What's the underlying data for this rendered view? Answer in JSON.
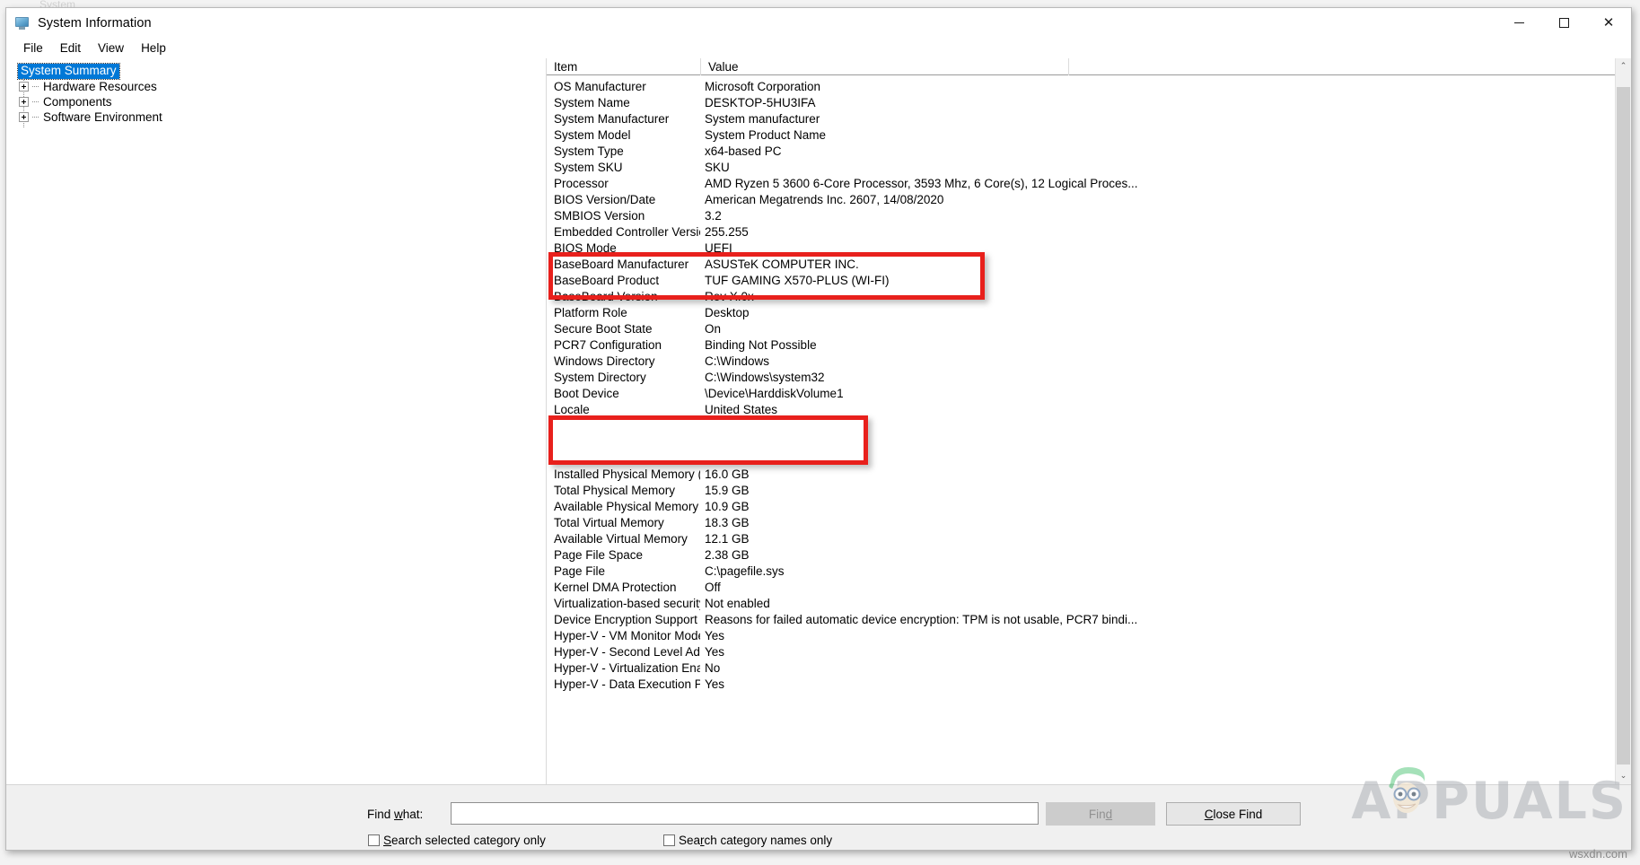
{
  "window": {
    "title": "System Information",
    "icon": "system-information-icon",
    "controls": {
      "minimize": "–",
      "maximize": "□",
      "close": "✕"
    }
  },
  "menu": {
    "items": [
      "File",
      "Edit",
      "View",
      "Help"
    ]
  },
  "tree": {
    "root": {
      "label": "System Summary",
      "selected": true
    },
    "children": [
      {
        "label": "Hardware Resources",
        "expanded": false
      },
      {
        "label": "Components",
        "expanded": false
      },
      {
        "label": "Software Environment",
        "expanded": false
      }
    ]
  },
  "list": {
    "columns": [
      "Item",
      "Value"
    ],
    "rows": [
      {
        "item": "OS Manufacturer",
        "value": "Microsoft Corporation"
      },
      {
        "item": "System Name",
        "value": "DESKTOP-5HU3IFA"
      },
      {
        "item": "System Manufacturer",
        "value": "System manufacturer"
      },
      {
        "item": "System Model",
        "value": "System Product Name"
      },
      {
        "item": "System Type",
        "value": "x64-based PC"
      },
      {
        "item": "System SKU",
        "value": "SKU"
      },
      {
        "item": "Processor",
        "value": "AMD Ryzen 5 3600 6-Core Processor, 3593 Mhz, 6 Core(s), 12 Logical Proces..."
      },
      {
        "item": "BIOS Version/Date",
        "value": "American Megatrends Inc. 2607, 14/08/2020"
      },
      {
        "item": "SMBIOS Version",
        "value": "3.2"
      },
      {
        "item": "Embedded Controller Version",
        "value": "255.255"
      },
      {
        "item": "BIOS Mode",
        "value": "UEFI"
      },
      {
        "item": "BaseBoard Manufacturer",
        "value": "ASUSTeK COMPUTER INC."
      },
      {
        "item": "BaseBoard Product",
        "value": "TUF GAMING X570-PLUS (WI-FI)"
      },
      {
        "item": "BaseBoard Version",
        "value": "Rev X.0x"
      },
      {
        "item": "Platform Role",
        "value": "Desktop"
      },
      {
        "item": "Secure Boot State",
        "value": "On"
      },
      {
        "item": "PCR7 Configuration",
        "value": "Binding Not Possible"
      },
      {
        "item": "Windows Directory",
        "value": "C:\\Windows"
      },
      {
        "item": "System Directory",
        "value": "C:\\Windows\\system32"
      },
      {
        "item": "Boot Device",
        "value": "\\Device\\HarddiskVolume1"
      },
      {
        "item": "Locale",
        "value": "United States"
      },
      {
        "item": "",
        "value": ""
      },
      {
        "item": "",
        "value": ""
      },
      {
        "item": "",
        "value": ""
      },
      {
        "item": "Installed Physical Memory (RAM)",
        "value": "16.0 GB"
      },
      {
        "item": "Total Physical Memory",
        "value": "15.9 GB"
      },
      {
        "item": "Available Physical Memory",
        "value": "10.9 GB"
      },
      {
        "item": "Total Virtual Memory",
        "value": "18.3 GB"
      },
      {
        "item": "Available Virtual Memory",
        "value": "12.1 GB"
      },
      {
        "item": "Page File Space",
        "value": "2.38 GB"
      },
      {
        "item": "Page File",
        "value": "C:\\pagefile.sys"
      },
      {
        "item": "Kernel DMA Protection",
        "value": "Off"
      },
      {
        "item": "Virtualization-based security",
        "value": "Not enabled"
      },
      {
        "item": "Device Encryption Support",
        "value": "Reasons for failed automatic device encryption: TPM is not usable, PCR7 bindi..."
      },
      {
        "item": "Hyper-V - VM Monitor Mode E...",
        "value": "Yes"
      },
      {
        "item": "Hyper-V - Second Level Addres...",
        "value": "Yes"
      },
      {
        "item": "Hyper-V - Virtualization Enable...",
        "value": "No"
      },
      {
        "item": "Hyper-V - Data Execution Prote...",
        "value": "Yes"
      }
    ]
  },
  "annotations": {
    "highlight_color": "#e8201c",
    "boxes": [
      {
        "name": "baseboard-highlight",
        "note": "Outlines BaseBoard Manufacturer / Product rows"
      },
      {
        "name": "blank-rows-highlight",
        "note": "Outlines empty rows below Locale"
      }
    ]
  },
  "find_bar": {
    "label": "Find what:",
    "label_accel": "w",
    "input_value": "",
    "input_placeholder": "",
    "find_button": "Find",
    "find_button_accel": "d",
    "find_button_enabled": false,
    "close_button": "Close Find",
    "close_button_accel": "C",
    "checkboxes": [
      {
        "label": "Search selected category only",
        "accel": "S",
        "checked": false
      },
      {
        "label": "Search category names only",
        "accel": "r",
        "checked": false
      }
    ]
  },
  "scrollbar": {
    "up_arrow": "⌃",
    "down_arrow": "⌄"
  },
  "watermark": {
    "brand": "APPUALS",
    "site": "wsxdn.com"
  }
}
